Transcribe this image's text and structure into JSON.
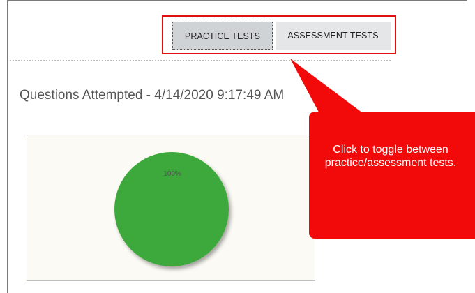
{
  "tabs": {
    "practice_label": "PRACTICE TESTS",
    "assessment_label": "ASSESSMENT TESTS",
    "active": "practice"
  },
  "title": "Questions Attempted - 4/14/2020 9:17:49 AM",
  "callout": {
    "text": "Click to toggle between practice/assessment tests.",
    "color": "#f20a0a"
  },
  "chart_data": {
    "type": "pie",
    "slices": [
      {
        "label": "100%",
        "value": 100,
        "color": "#3ea83a"
      }
    ]
  },
  "colors": {
    "highlight_border": "#e01010",
    "tab_active_bg": "#cfd3d6",
    "tab_inactive_bg": "#e4e6e8",
    "chart_bg": "#fcfaf4"
  }
}
